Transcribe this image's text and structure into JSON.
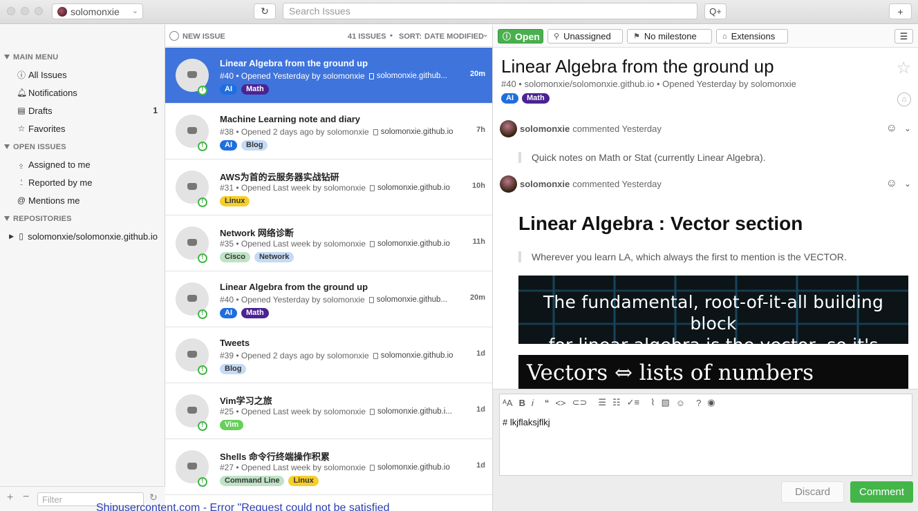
{
  "titlebar": {
    "account_name": "solomonxie",
    "search_placeholder": "Search Issues",
    "new_label": "+"
  },
  "sidebar": {
    "main_menu_title": "MAIN MENU",
    "main_menu": [
      {
        "label": "All Issues",
        "icon": "issue-icon"
      },
      {
        "label": "Notifications",
        "icon": "bell-icon"
      },
      {
        "label": "Drafts",
        "icon": "drafts-icon",
        "count": "1"
      },
      {
        "label": "Favorites",
        "icon": "star-icon"
      }
    ],
    "open_issues_title": "OPEN ISSUES",
    "open_issues": [
      {
        "label": "Assigned to me",
        "icon": "assigned-icon"
      },
      {
        "label": "Reported by me",
        "icon": "reported-icon"
      },
      {
        "label": "Mentions me",
        "icon": "at-icon"
      }
    ],
    "repositories_title": "REPOSITORIES",
    "repositories": [
      {
        "label": "solomonxie/solomonxie.github.io"
      }
    ],
    "filter_placeholder": "Filter"
  },
  "list": {
    "new_issue_label": "NEW ISSUE",
    "count_label": "41 ISSUES",
    "sort_label": "SORT:",
    "sort_value": "DATE MODIFIED",
    "issues": [
      {
        "title": "Linear Algebra from the ground up",
        "meta": "#40 • Opened Yesterday by solomonxie",
        "repo": "solomonxie.github...",
        "age": "20m",
        "selected": true,
        "labels": [
          {
            "name": "AI",
            "color": "#1f6ee0",
            "text": "#ffffff"
          },
          {
            "name": "Math",
            "color": "#4b2392",
            "text": "#ffffff"
          }
        ]
      },
      {
        "title": "Machine Learning note and diary",
        "meta": "#38 • Opened 2 days ago by solomonxie",
        "repo": "solomonxie.github.io",
        "age": "7h",
        "labels": [
          {
            "name": "AI",
            "color": "#1f6ee0",
            "text": "#ffffff"
          },
          {
            "name": "Blog",
            "color": "#c5daf5",
            "text": "#333333"
          }
        ]
      },
      {
        "title": "AWS为首的云服务器实战钻研",
        "meta": "#31 • Opened Last week by solomonxie",
        "repo": "solomonxie.github.io",
        "age": "10h",
        "labels": [
          {
            "name": "Linux",
            "color": "#f6cf2a",
            "text": "#333333"
          }
        ]
      },
      {
        "title": "Network 网络诊断",
        "meta": "#35 • Opened Last week by solomonxie",
        "repo": "solomonxie.github.io",
        "age": "11h",
        "labels": [
          {
            "name": "Cisco",
            "color": "#bfe3c4",
            "text": "#333333"
          },
          {
            "name": "Network",
            "color": "#c5daf5",
            "text": "#333333"
          }
        ]
      },
      {
        "title": "Linear Algebra from the ground up",
        "meta": "#40 • Opened Yesterday by solomonxie",
        "repo": "solomonxie.github...",
        "age": "20m",
        "labels": [
          {
            "name": "AI",
            "color": "#1f6ee0",
            "text": "#ffffff"
          },
          {
            "name": "Math",
            "color": "#4b2392",
            "text": "#ffffff"
          }
        ]
      },
      {
        "title": "Tweets",
        "meta": "#39 • Opened 2 days ago by solomonxie",
        "repo": "solomonxie.github.io",
        "age": "1d",
        "labels": [
          {
            "name": "Blog",
            "color": "#c5daf5",
            "text": "#333333"
          }
        ]
      },
      {
        "title": "Vim学习之旅",
        "meta": "#25 • Opened Last week by solomonxie",
        "repo": "solomonxie.github.i...",
        "age": "1d",
        "labels": [
          {
            "name": "Vim",
            "color": "#67cf5a",
            "text": "#ffffff"
          }
        ]
      },
      {
        "title": "Shells 命令行终端操作积累",
        "meta": "#27 • Opened Last week by solomonxie",
        "repo": "solomonxie.github.io",
        "age": "1d",
        "labels": [
          {
            "name": "Command Line",
            "color": "#bfe3c4",
            "text": "#333333"
          },
          {
            "name": "Linux",
            "color": "#f6cf2a",
            "text": "#333333"
          }
        ]
      }
    ]
  },
  "detail": {
    "status": "Open",
    "assignee": "Unassigned",
    "milestone": "No milestone",
    "extensions": "Extensions",
    "title": "Linear Algebra from the ground up",
    "meta": "#40 • solomonxie/solomonxie.github.io • Opened Yesterday by solomonxie",
    "labels": [
      {
        "name": "AI",
        "color": "#1f6ee0",
        "text": "#ffffff"
      },
      {
        "name": "Math",
        "color": "#4b2392",
        "text": "#ffffff"
      }
    ],
    "comments": [
      {
        "author": "solomonxie",
        "action": "commented Yesterday",
        "quote": "Quick notes on Math or Stat (currently Linear Algebra)."
      },
      {
        "author": "solomonxie",
        "action": "commented Yesterday"
      }
    ],
    "heading": "Linear Algebra : Vector section",
    "quote2": "Wherever you learn LA, which always the first to mention is the VECTOR.",
    "image1_caption_line1": "The fundamental, root-of-it-all building block",
    "image1_caption_line2": "for linear algebra is the vector, so it's",
    "image2_caption": "Vectors ⇔ lists of numbers",
    "editor_text": "# lkjflaksjflkj",
    "discard_label": "Discard",
    "comment_label": "Comment"
  },
  "background_text": "Shipusercontent.com - Error \"Request could not be satisfied"
}
